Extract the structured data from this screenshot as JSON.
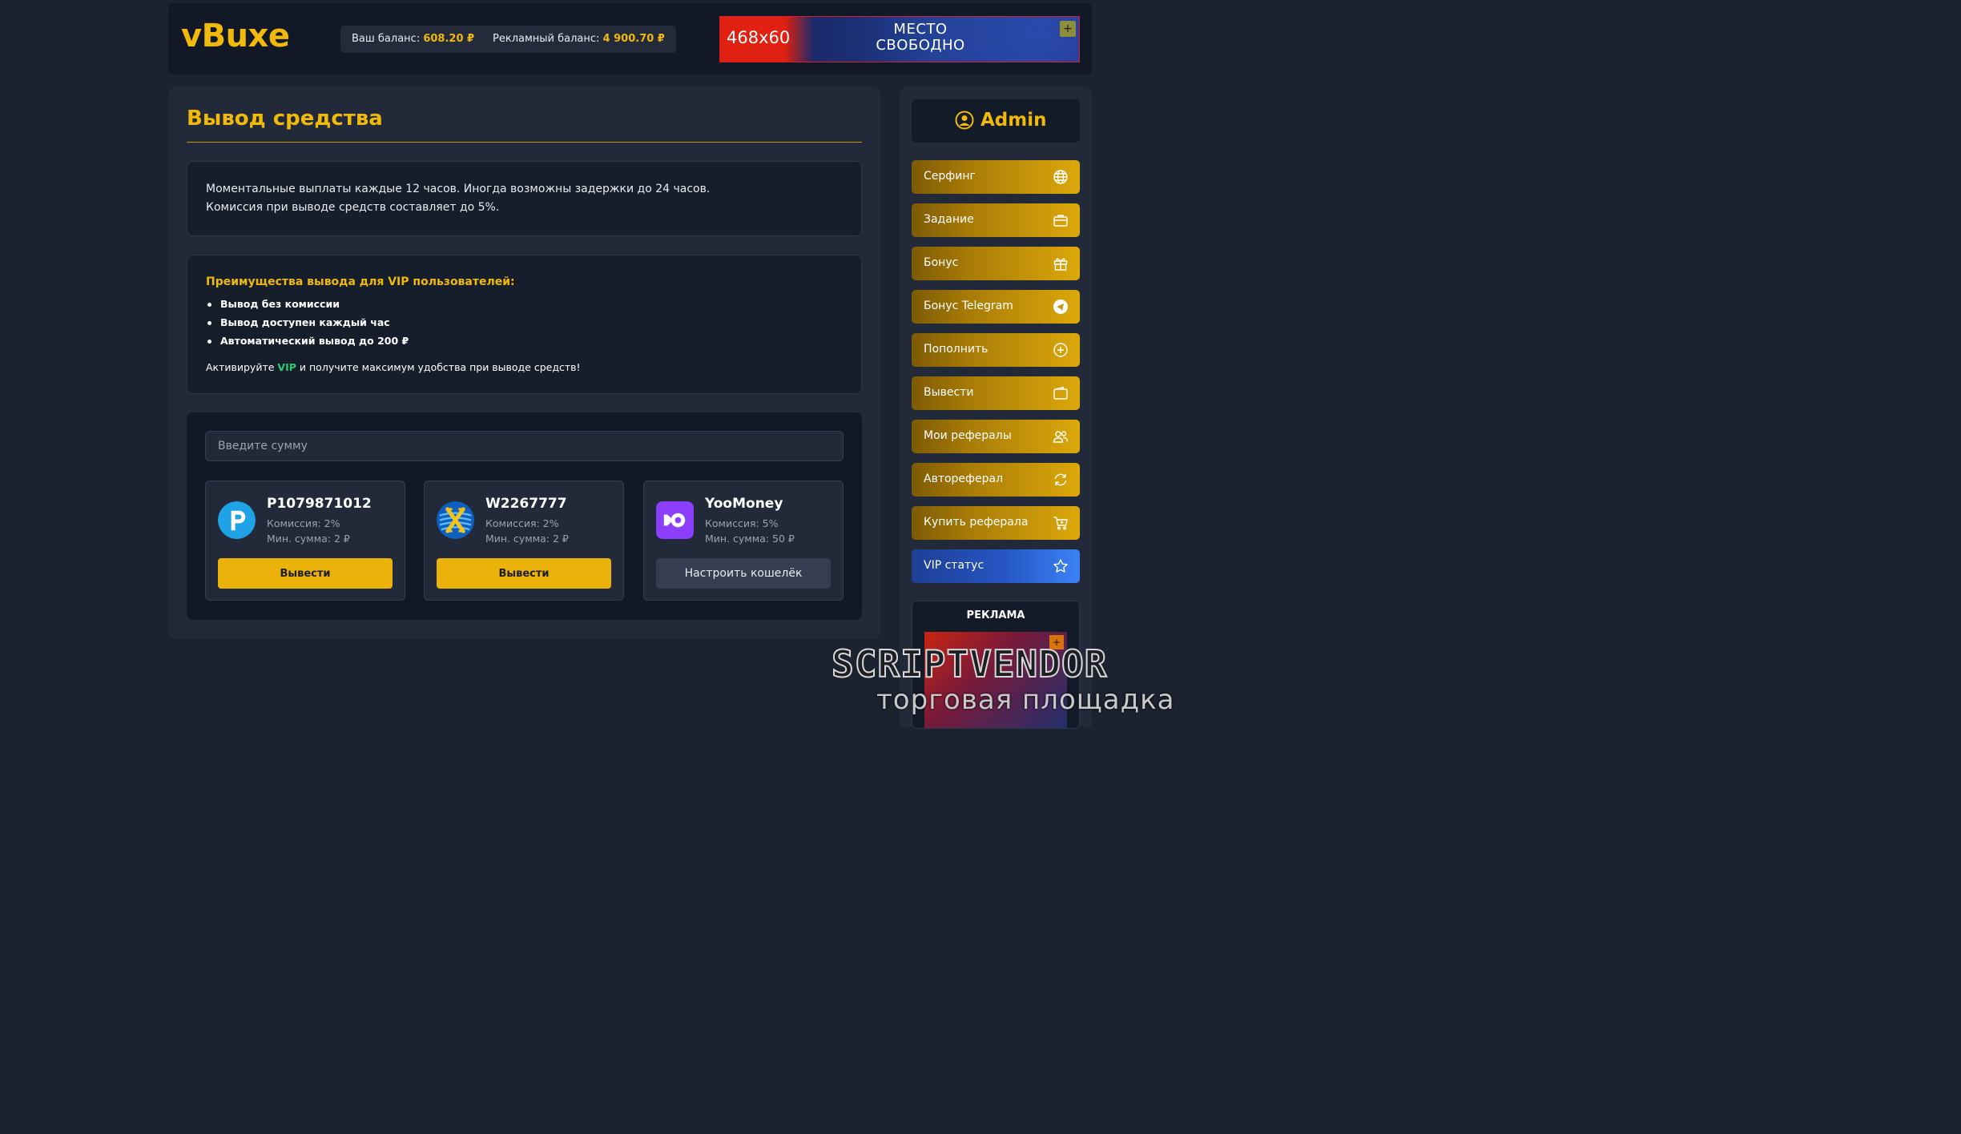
{
  "header": {
    "logo": "vBuxe",
    "balance_label": "Ваш баланс:",
    "balance_value": "608.20 ₽",
    "ad_balance_label": "Рекламный баланс:",
    "ad_balance_value": "4 900.70 ₽",
    "banner": {
      "size": "468x60",
      "line1": "МЕСТО",
      "line2": "СВОБОДНО",
      "plus": "+"
    }
  },
  "main": {
    "title": "Вывод средства",
    "info_line1": "Моментальные выплаты каждые 12 часов. Иногда возможны задержки до 24 часов.",
    "info_line2": "Комиссия при выводе средств составляет до 5%.",
    "vip": {
      "title": "Преимущества вывода для VIP пользователей:",
      "items": [
        "Вывод без комиссии",
        "Вывод доступен каждый час",
        "Автоматический вывод до 200 ₽"
      ],
      "cta_before": "Активируйте",
      "cta_vip": "VIP",
      "cta_after": "и получите максимум удобства при выводе средств!"
    },
    "amount_placeholder": "Введите сумму",
    "wallets": [
      {
        "name": "P1079871012",
        "fee": "Комиссия: 2%",
        "min": "Мин. сумма: 2 ₽",
        "button": "Вывести",
        "icon": "payeer-icon"
      },
      {
        "name": "W2267777",
        "fee": "Комиссия: 2%",
        "min": "Мин. сумма: 2 ₽",
        "button": "Вывести",
        "icon": "advcash-icon"
      },
      {
        "name": "YooMoney",
        "fee": "Комиссия: 5%",
        "min": "Мин. сумма: 50 ₽",
        "button": "Настроить кошелёк",
        "icon": "yoomoney-icon"
      }
    ]
  },
  "sidebar": {
    "username": "Admin",
    "nav": [
      {
        "label": "Серфинг",
        "icon": "globe-icon"
      },
      {
        "label": "Задание",
        "icon": "briefcase-icon"
      },
      {
        "label": "Бонус",
        "icon": "gift-icon"
      },
      {
        "label": "Бонус Telegram",
        "icon": "telegram-icon"
      },
      {
        "label": "Пополнить",
        "icon": "plus-circle-icon"
      },
      {
        "label": "Вывести",
        "icon": "wallet-icon"
      },
      {
        "label": "Мои рефералы",
        "icon": "users-icon"
      },
      {
        "label": "Автореферал",
        "icon": "refresh-icon"
      },
      {
        "label": "Купить реферала",
        "icon": "cart-icon"
      },
      {
        "label": "VIP статус",
        "icon": "star-icon"
      }
    ],
    "ad_title": "РЕКЛАМА",
    "ad_plus": "+"
  },
  "watermark": {
    "line1": "SCRIPTVENDOR",
    "line2": "торговая площадка"
  },
  "colors": {
    "accent": "#f0b90b",
    "vip_green": "#2ecc71",
    "vip_blue": "#2656c4",
    "background": "#1b2230"
  }
}
